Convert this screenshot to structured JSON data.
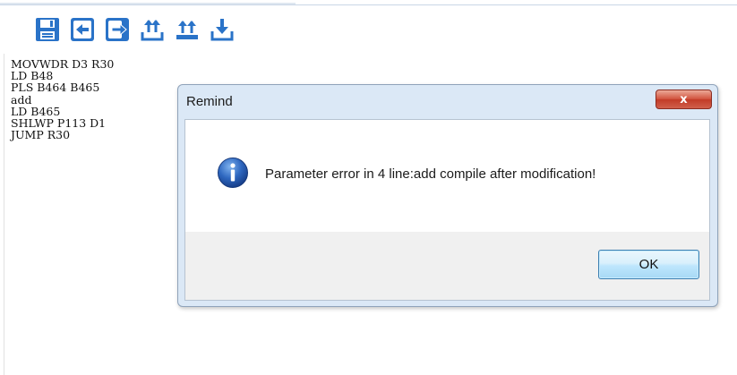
{
  "toolbar": {
    "buttons": [
      {
        "icon": "save-icon"
      },
      {
        "icon": "import-icon"
      },
      {
        "icon": "export-icon"
      },
      {
        "icon": "upload-icon"
      },
      {
        "icon": "upload-all-icon"
      },
      {
        "icon": "download-icon"
      }
    ]
  },
  "editor": {
    "lines": [
      "MOVWDR D3 R30",
      "LD B48",
      "PLS B464 B465",
      "add",
      "LD B465",
      "SHLWP P113 D1",
      "JUMP R30"
    ]
  },
  "dialog": {
    "title": "Remind",
    "close_label": "x",
    "icon": "info-icon",
    "message": "Parameter error in 4 line:add compile after modification!",
    "ok_label": "OK"
  },
  "colors": {
    "toolbar_icon": "#2a73c8",
    "dialog_frame": "#dbe8f6",
    "close_button": "#c8452f",
    "ok_button_border": "#3c7fb1",
    "info_icon": "#2a5fb0"
  }
}
